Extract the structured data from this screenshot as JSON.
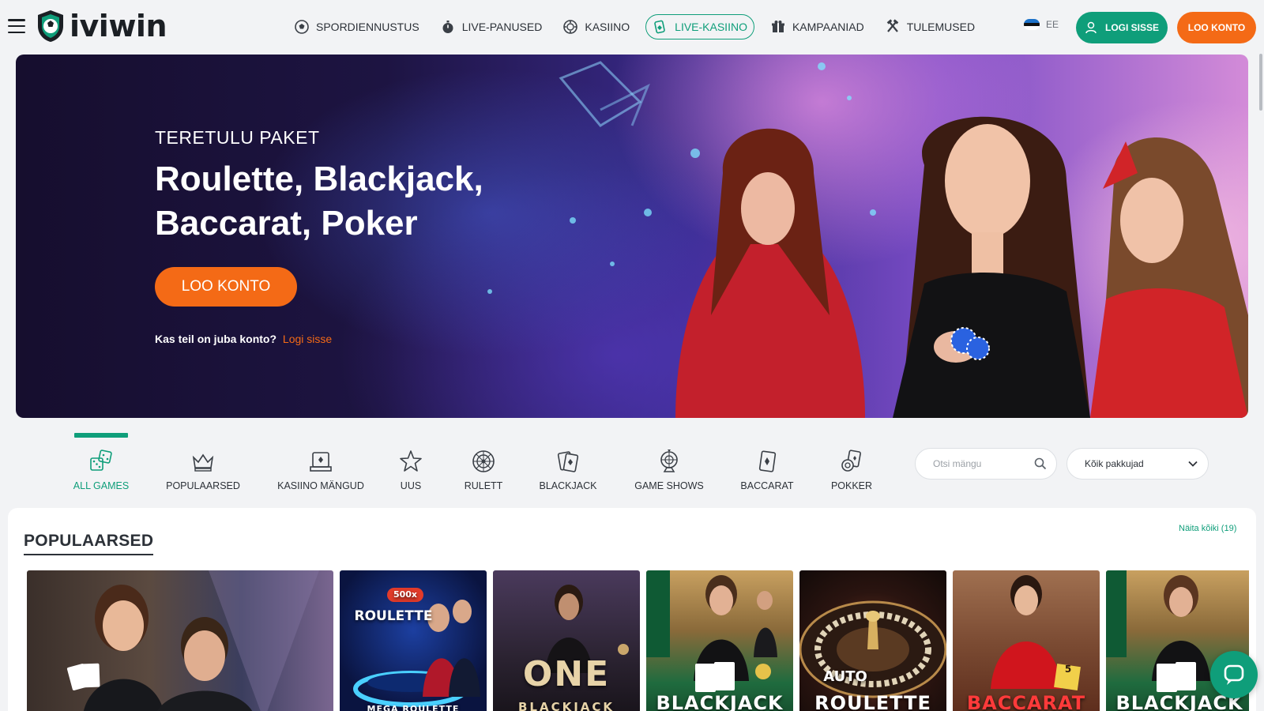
{
  "header": {
    "brand": "iviwin",
    "nav": [
      {
        "label": "SPORDIENNUSTUS",
        "icon": "soccer-ball-icon"
      },
      {
        "label": "LIVE-PANUSED",
        "icon": "stopwatch-icon"
      },
      {
        "label": "KASIINO",
        "icon": "casino-chip-icon"
      },
      {
        "label": "LIVE-KASIINO",
        "icon": "live-cards-icon",
        "active": true
      },
      {
        "label": "KAMPAANIAD",
        "icon": "gift-icon"
      },
      {
        "label": "TULEMUSED",
        "icon": "crossed-hammers-icon"
      }
    ],
    "language": "EE",
    "login_label": "LOGI SISSE",
    "register_label": "LOO KONTO"
  },
  "hero": {
    "eyebrow": "TERETULU PAKET",
    "title": "Roulette, Blackjack, Baccarat, Poker",
    "cta": "LOO KONTO",
    "sub_text": "Kas teil on juba konto?",
    "sub_link": "Logi sisse"
  },
  "categories": [
    {
      "label": "ALL GAMES",
      "icon": "dice-icon",
      "active": true
    },
    {
      "label": "POPULAARSED",
      "icon": "crown-icon"
    },
    {
      "label": "KASIINO MÄNGUD",
      "icon": "slot-machine-icon"
    },
    {
      "label": "UUS",
      "icon": "star-icon"
    },
    {
      "label": "RULETT",
      "icon": "roulette-wheel-icon"
    },
    {
      "label": "BLACKJACK",
      "icon": "playing-cards-icon"
    },
    {
      "label": "GAME SHOWS",
      "icon": "game-show-wheel-icon"
    },
    {
      "label": "BACCARAT",
      "icon": "card-icon"
    },
    {
      "label": "POKKER",
      "icon": "poker-chips-icon"
    }
  ],
  "search": {
    "placeholder": "Otsi mängu"
  },
  "provider": {
    "selected": "Kõik pakkujad"
  },
  "section": {
    "title": "POPULAARSED",
    "see_all": "Näita kõiki (19)"
  },
  "games": [
    {
      "label": ""
    },
    {
      "label": "MEGA ROULETTE",
      "badge": "500x",
      "logo": "ROULETTE"
    },
    {
      "label": "BLACKJACK",
      "logo": "ONE"
    },
    {
      "label": "BLACKJACK"
    },
    {
      "label": "ROULETTE",
      "logo": "AUTO"
    },
    {
      "label": "BACCARAT",
      "badge": "5"
    },
    {
      "label": "BLACKJACK"
    }
  ],
  "colors": {
    "brand_green": "#0f9e7a",
    "brand_orange": "#f46a16",
    "text_dark": "#2c3138"
  }
}
